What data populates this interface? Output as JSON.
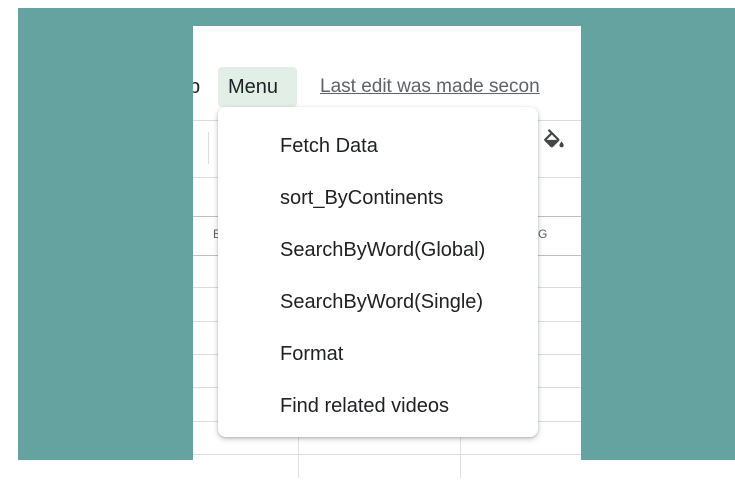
{
  "menubar": {
    "help_fragment": "p",
    "menu_label": "Menu",
    "last_edit": "Last edit was made secon"
  },
  "column_headers": {
    "b": "B",
    "g": "G"
  },
  "dropdown": {
    "items": [
      {
        "label": "Fetch Data"
      },
      {
        "label": "sort_ByContinents"
      },
      {
        "label": "SearchByWord(Global)"
      },
      {
        "label": "SearchByWord(Single)"
      },
      {
        "label": "Format"
      },
      {
        "label": "Find related videos"
      }
    ]
  },
  "icons": {
    "fill_color": "paint-bucket-icon"
  },
  "colors": {
    "frame": "#64a39f",
    "menu_highlight": "#e1efe6"
  }
}
